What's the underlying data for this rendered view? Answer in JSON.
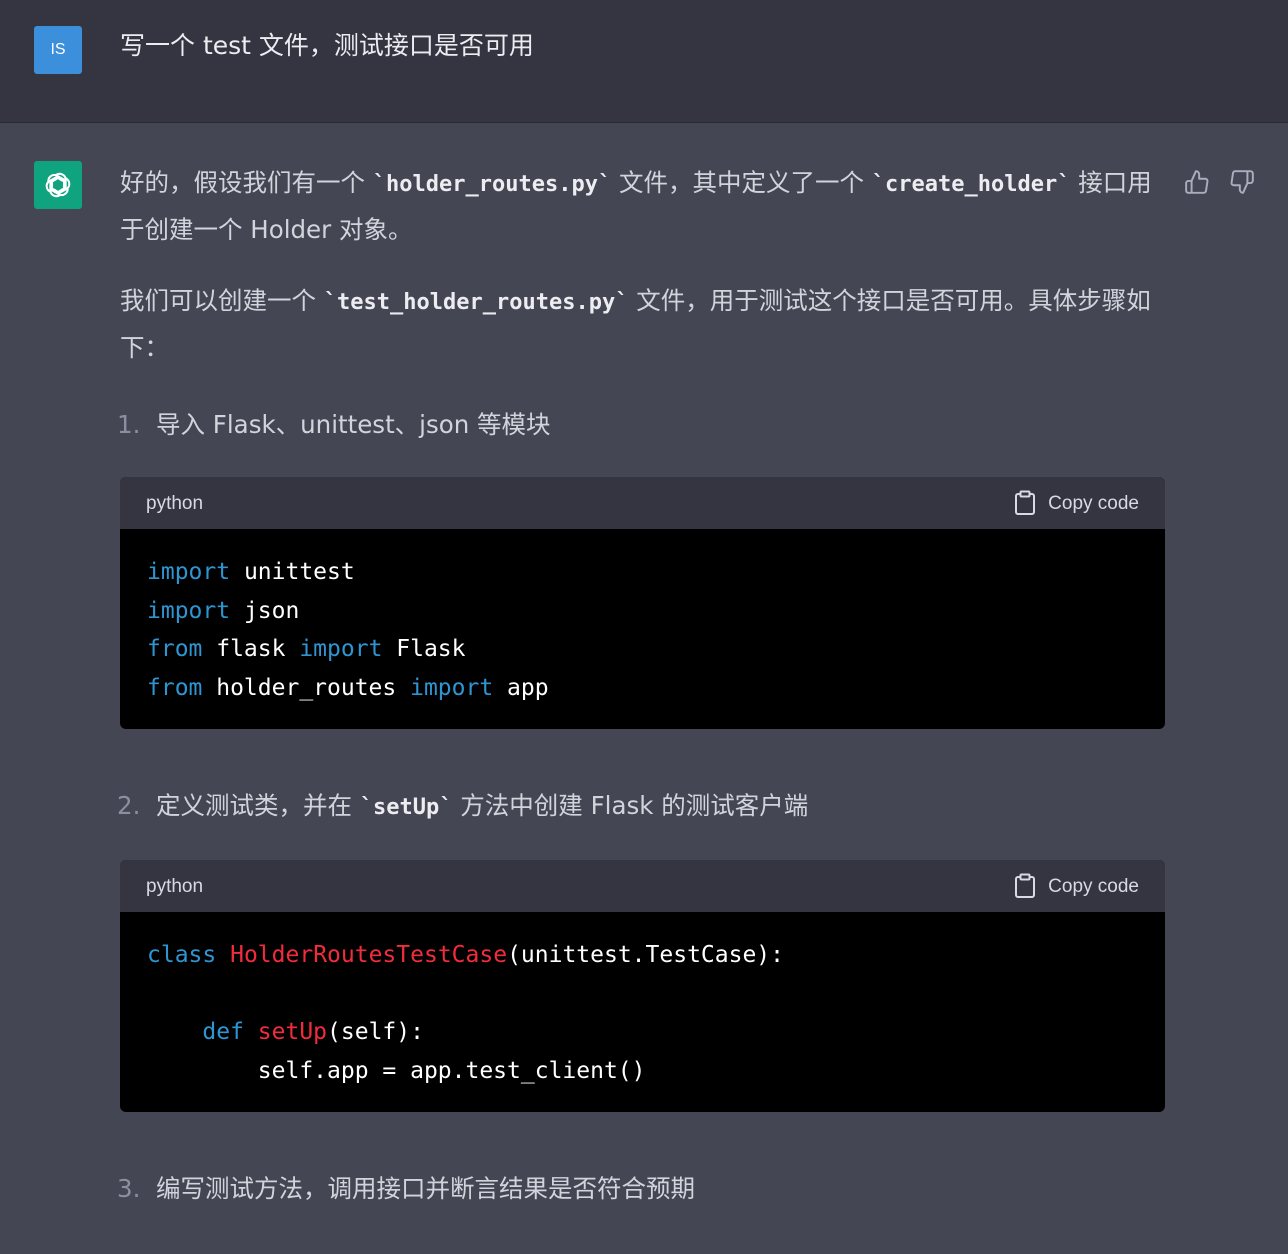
{
  "user": {
    "avatar_text": "IS",
    "message": "写一个 test 文件，测试接口是否可用"
  },
  "assistant": {
    "avatar_icon": "openai-logo-icon",
    "feedback": {
      "thumbs_up_icon": "thumbs-up-icon",
      "thumbs_down_icon": "thumbs-down-icon"
    },
    "intro": {
      "p1_a": "好的，假设我们有一个 ",
      "p1_code1": "`holder_routes.py`",
      "p1_b": " 文件，其中定义了一个 ",
      "p1_code2": "`create_holder`",
      "p1_c": " 接口用于创建一个 Holder 对象。",
      "p2_a": "我们可以创建一个 ",
      "p2_code": "`test_holder_routes.py`",
      "p2_b": " 文件，用于测试这个接口是否可用。具体步骤如下："
    },
    "steps": [
      {
        "num": "1.",
        "text": "导入 Flask、unittest、json 等模块"
      },
      {
        "num": "2.",
        "text_a": "定义测试类，并在 ",
        "code": "`setUp`",
        "text_b": " 方法中创建 Flask 的测试客户端"
      },
      {
        "num": "3.",
        "text": "编写测试方法，调用接口并断言结果是否符合预期"
      }
    ],
    "code_blocks": [
      {
        "language": "python",
        "copy_label": "Copy code",
        "lines": [
          [
            {
              "t": "import",
              "c": "kw"
            },
            {
              "t": " unittest",
              "c": ""
            }
          ],
          [
            {
              "t": "import",
              "c": "kw"
            },
            {
              "t": " json",
              "c": ""
            }
          ],
          [
            {
              "t": "from",
              "c": "kw"
            },
            {
              "t": " flask ",
              "c": ""
            },
            {
              "t": "import",
              "c": "kw"
            },
            {
              "t": " Flask",
              "c": ""
            }
          ],
          [
            {
              "t": "from",
              "c": "kw"
            },
            {
              "t": " holder_routes ",
              "c": ""
            },
            {
              "t": "import",
              "c": "kw"
            },
            {
              "t": " app",
              "c": ""
            }
          ]
        ]
      },
      {
        "language": "python",
        "copy_label": "Copy code",
        "lines": [
          [
            {
              "t": "class",
              "c": "kw"
            },
            {
              "t": " ",
              "c": ""
            },
            {
              "t": "HolderRoutesTestCase",
              "c": "fn"
            },
            {
              "t": "(unittest.TestCase):",
              "c": ""
            }
          ],
          [],
          [
            {
              "t": "    ",
              "c": ""
            },
            {
              "t": "def",
              "c": "kw"
            },
            {
              "t": " ",
              "c": ""
            },
            {
              "t": "setUp",
              "c": "fn"
            },
            {
              "t": "(self):",
              "c": ""
            }
          ],
          [
            {
              "t": "        self.app = app.test_client()",
              "c": ""
            }
          ]
        ]
      }
    ]
  },
  "colors": {
    "keyword": "#2e95d3",
    "function": "#f22c3d",
    "brand": "#10a37f",
    "user_avatar": "#3b8fdb"
  }
}
